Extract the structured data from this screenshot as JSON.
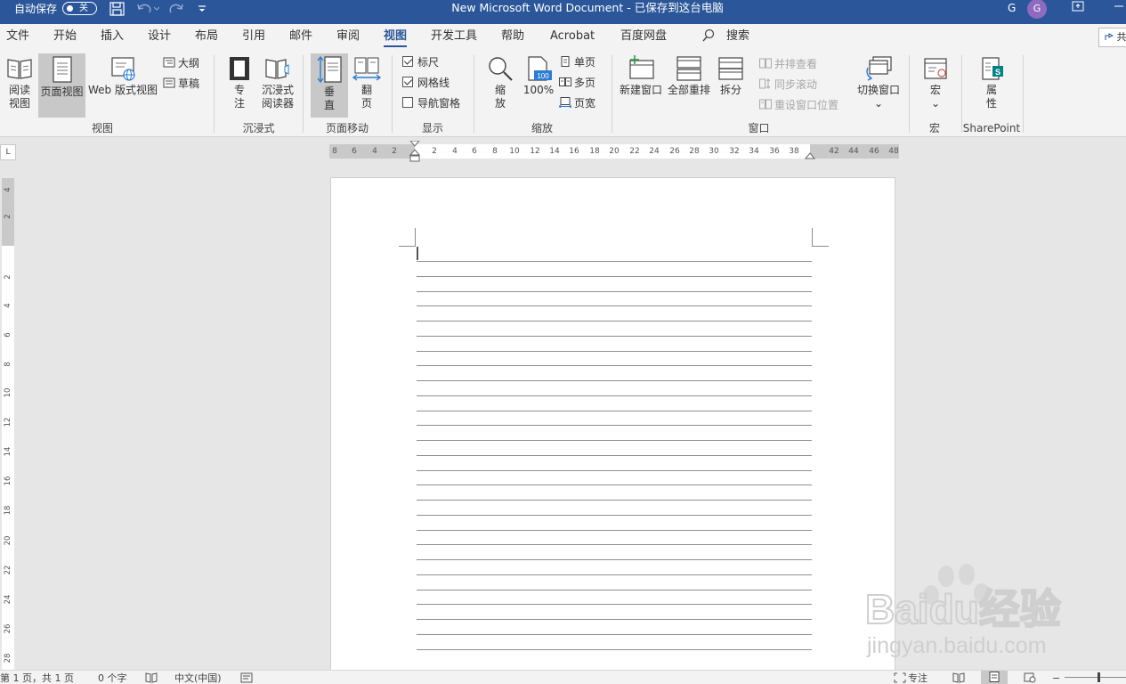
{
  "titlebar": {
    "autosave_label": "自动保存",
    "autosave_state": "关",
    "document_title": "New Microsoft Word Document - 已保存到这台电脑",
    "user_initial": "G",
    "avatar_initial": "G",
    "background_color": "#2b579a",
    "avatar_color": "#8e6bbf"
  },
  "tabs": {
    "items": [
      "文件",
      "开始",
      "插入",
      "设计",
      "布局",
      "引用",
      "邮件",
      "审阅",
      "视图",
      "开发工具",
      "帮助",
      "Acrobat",
      "百度网盘"
    ],
    "active": "视图",
    "search_label": "搜索",
    "share_label": "共"
  },
  "ribbon": {
    "views": {
      "group_label": "视图",
      "read_mode": "阅读\n视图",
      "print_layout": "页面视图",
      "web_layout": "Web 版式视图",
      "outline": "大纲",
      "draft": "草稿"
    },
    "immersive": {
      "group_label": "沉浸式",
      "focus": "专\n注",
      "immersive_reader": "沉浸式\n阅读器"
    },
    "page_movement": {
      "group_label": "页面移动",
      "vertical": "垂\n直",
      "side_to_side": "翻\n页"
    },
    "show": {
      "group_label": "显示",
      "ruler": "标尺",
      "ruler_checked": true,
      "gridlines": "网格线",
      "gridlines_checked": true,
      "navigation_pane": "导航窗格",
      "navigation_pane_checked": false
    },
    "zoom": {
      "group_label": "缩放",
      "zoom": "缩\n放",
      "zoom_100": "100%",
      "zoom_100_icon_text": "100",
      "one_page": "单页",
      "multiple_pages": "多页",
      "page_width": "页宽"
    },
    "window": {
      "group_label": "窗口",
      "new_window": "新建窗口",
      "arrange_all": "全部重排",
      "split": "拆分",
      "view_side_by_side": "并排查看",
      "synchronous_scrolling": "同步滚动",
      "reset_window_position": "重设窗口位置",
      "switch_windows": "切换窗口",
      "switch_windows_arrow": "⌄"
    },
    "macros": {
      "group_label": "宏",
      "macros": "宏",
      "macros_arrow": "⌄"
    },
    "sharepoint": {
      "group_label": "SharePoint",
      "properties": "属\n性",
      "sharepoint_icon_text": "S"
    }
  },
  "ruler": {
    "tab_selector": "L",
    "horizontal_ticks": [
      "8",
      "6",
      "4",
      "2",
      "2",
      "4",
      "6",
      "8",
      "10",
      "12",
      "14",
      "16",
      "18",
      "20",
      "22",
      "24",
      "26",
      "28",
      "30",
      "32",
      "34",
      "36",
      "38",
      "42",
      "44",
      "46",
      "48"
    ],
    "vertical_ticks": [
      "4",
      "2",
      "2",
      "4",
      "6",
      "8",
      "10",
      "12",
      "14",
      "16",
      "18",
      "20",
      "22",
      "24",
      "26",
      "28"
    ]
  },
  "statusbar": {
    "page_info": "第 1 页，共 1 页",
    "word_count": "0 个字",
    "language": "中文(中国)",
    "focus_label": "专注",
    "zoom_minus": "−"
  },
  "watermark": {
    "brand": "Baidu经验",
    "url": "jingyan.baidu.com"
  }
}
